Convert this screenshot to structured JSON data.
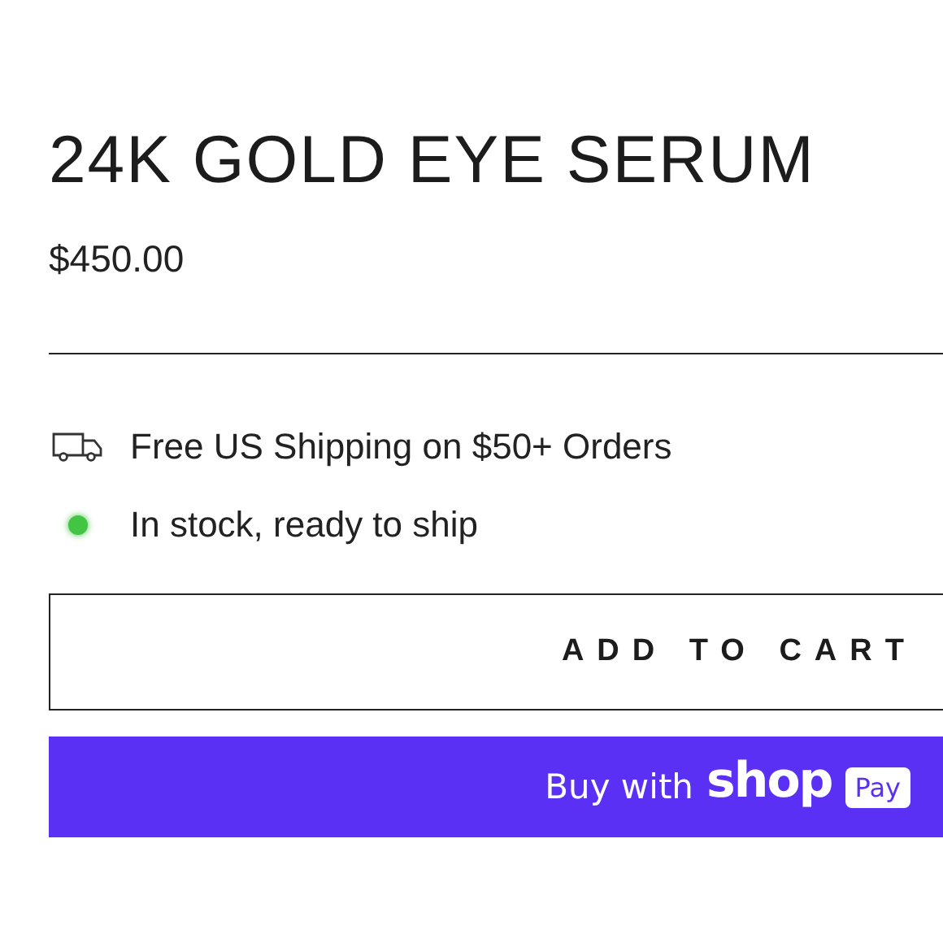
{
  "product": {
    "title": "24K GOLD EYE SERUM",
    "price": "$450.00"
  },
  "info": [
    {
      "kind": "shipping",
      "text": "Free US Shipping on $50+ Orders"
    },
    {
      "kind": "stock",
      "text": "In stock, ready to ship",
      "color": "#43c443"
    }
  ],
  "add_to_cart": {
    "label": "ADD TO CART"
  },
  "shop_pay": {
    "prefix": "Buy with",
    "brand": "shop",
    "badge": "Pay"
  }
}
